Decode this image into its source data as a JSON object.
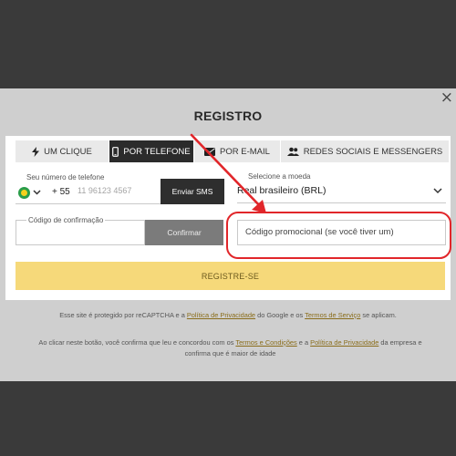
{
  "modal": {
    "title": "REGISTRO",
    "close_glyph": "×"
  },
  "tabs": [
    {
      "label": "UM CLIQUE",
      "icon": "lightning-icon",
      "active": false
    },
    {
      "label": "POR TELEFONE",
      "icon": "phone-icon",
      "active": true
    },
    {
      "label": "POR E-MAIL",
      "icon": "envelope-icon",
      "active": false
    },
    {
      "label": "REDES SOCIAIS E MESSENGERS",
      "icon": "users-icon",
      "active": false
    }
  ],
  "phone": {
    "label": "Seu número de telefone",
    "country_code": "+ 55",
    "placeholder": "11 96123 4567",
    "send_sms_label": "Enviar SMS"
  },
  "currency": {
    "label": "Selecione a moeda",
    "value": "Real brasileiro (BRL)"
  },
  "confirmation": {
    "label": "Código de confirmação",
    "confirm_label": "Confirmar"
  },
  "promo": {
    "placeholder": "Código promocional (se você tiver um)"
  },
  "register_label": "REGISTRE-SE",
  "footer": {
    "line1_a": "Esse site é protegido por reCAPTCHA e a ",
    "line1_link1": "Política de Privacidade",
    "line1_b": " do Google e os ",
    "line1_link2": "Termos de Serviço",
    "line1_c": " se aplicam.",
    "line2_a": "Ao clicar neste botão, você confirma que leu e concordou com os ",
    "line2_link1": "Termos e Condições",
    "line2_b": " e a ",
    "line2_link2": "Política de Privacidade",
    "line2_c": " da empresa e confirma que é maior de idade"
  },
  "colors": {
    "annotation": "#e1262a",
    "register_button": "#f6d97a",
    "active_tab": "#2b2b2b"
  }
}
